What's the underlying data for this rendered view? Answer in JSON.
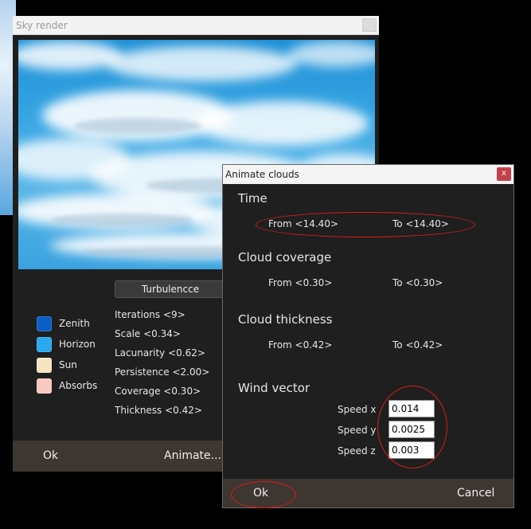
{
  "sky_window": {
    "title": "Sky render",
    "turbulence_button": "Turbulencce",
    "swatches": [
      {
        "label": "Zenith",
        "color": "#0b5fc4"
      },
      {
        "label": "Horizon",
        "color": "#29a9ee"
      },
      {
        "label": "Sun",
        "color": "#f7e5c2"
      },
      {
        "label": "Absorbs",
        "color": "#f7c9c0"
      }
    ],
    "params": [
      "Iterations <9>",
      "Scale <0.34>",
      "Lacunarity <0.62>",
      "Persistence <2.00>",
      "Coverage <0.30>",
      "Thickness <0.42>"
    ],
    "ok_label": "Ok",
    "animate_label": "Animate..."
  },
  "anim_dialog": {
    "title": "Animate clouds",
    "close_glyph": "x",
    "time": {
      "title": "Time",
      "from": "From <14.40>",
      "to": "To <14.40>"
    },
    "coverage": {
      "title": "Cloud coverage",
      "from": "From <0.30>",
      "to": "To <0.30>"
    },
    "thickness": {
      "title": "Cloud thickness",
      "from": "From <0.42>",
      "to": "To <0.42>"
    },
    "wind": {
      "title": "Wind vector",
      "speed_x_label": "Speed x",
      "speed_x": "0.014",
      "speed_y_label": "Speed y",
      "speed_y": "0.0025",
      "speed_z_label": "Speed z",
      "speed_z": "0.003"
    },
    "ok_label": "Ok",
    "cancel_label": "Cancel"
  },
  "colors": {
    "annotation": "#d81b1b",
    "footer": "#3e3630",
    "panel": "#1f1f1f"
  }
}
